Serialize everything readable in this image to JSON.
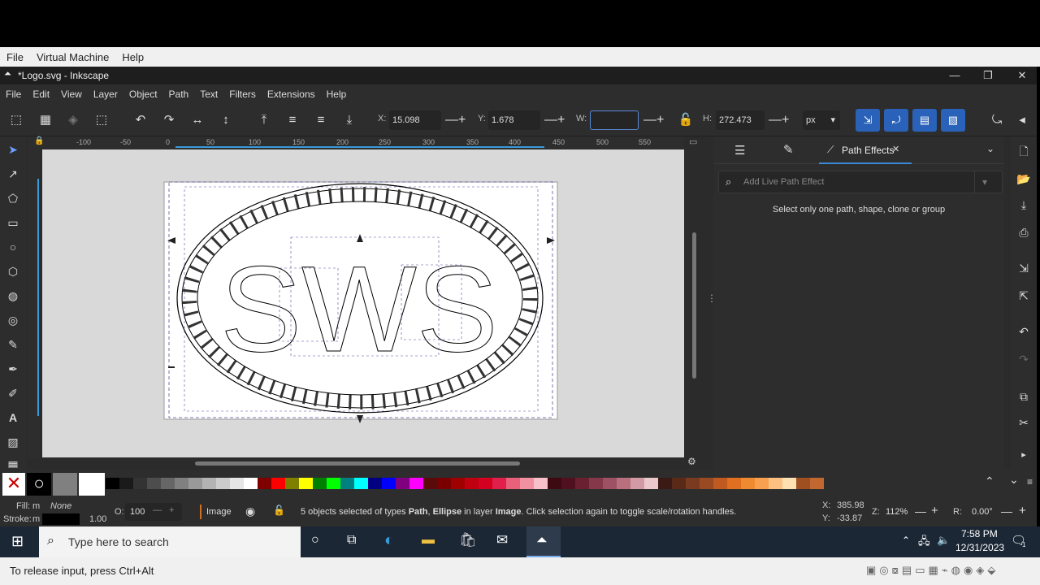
{
  "vm_menu": [
    "File",
    "Virtual Machine",
    "Help"
  ],
  "window": {
    "title": "*Logo.svg - Inkscape"
  },
  "menu": [
    "File",
    "Edit",
    "View",
    "Layer",
    "Object",
    "Path",
    "Text",
    "Filters",
    "Extensions",
    "Help"
  ],
  "toolbar": {
    "x_label": "X:",
    "x_value": "15.098",
    "y_label": "Y:",
    "y_value": "1.678",
    "w_label": "W:",
    "w_value": "",
    "h_label": "H:",
    "h_value": "272.473",
    "unit": "px"
  },
  "ruler": {
    "ticks": [
      "-100",
      "-50",
      "0",
      "50",
      "100",
      "150",
      "200",
      "250",
      "300",
      "350",
      "400",
      "450",
      "500",
      "550"
    ]
  },
  "panel": {
    "tab_label": "Path Effects",
    "search_placeholder": "Add Live Path Effect",
    "message": "Select only one path, shape, clone or group"
  },
  "status": {
    "fill_label": "Fill:",
    "fill_value": "m",
    "fill_none": "None",
    "stroke_label": "Stroke:",
    "stroke_value": "m",
    "stroke_width": "1.00",
    "opacity_label": "O:",
    "opacity_value": "100",
    "layer": "Image",
    "msg_pre": "5 objects selected of types ",
    "msg_types1": "Path",
    "msg_sep": ", ",
    "msg_types2": "Ellipse",
    "msg_mid": " in layer ",
    "msg_layer": "Image",
    "msg_post": ". Click selection again to toggle scale/rotation handles.",
    "x_coord": "385.98",
    "y_coord": "-33.87",
    "x_label": "X:",
    "y_label": "Y:",
    "zoom_label": "Z:",
    "zoom": "112%",
    "rot_label": "R:",
    "rotation": "0.00°"
  },
  "palette_colors": [
    "#000000",
    "#1a1a1a",
    "#333333",
    "#4d4d4d",
    "#666666",
    "#808080",
    "#999999",
    "#b3b3b3",
    "#cccccc",
    "#e6e6e6",
    "#ffffff",
    "#800000",
    "#ff0000",
    "#808000",
    "#ffff00",
    "#008000",
    "#00ff00",
    "#008080",
    "#00ffff",
    "#000080",
    "#0000ff",
    "#800080",
    "#ff00ff",
    "#5a0a0a",
    "#7a0000",
    "#a00000",
    "#c00010",
    "#d40020",
    "#e0204a",
    "#e8607a",
    "#f090a0",
    "#f8c0c8",
    "#3c0a10",
    "#501020",
    "#6a2030",
    "#84384a",
    "#9e5064",
    "#b8707e",
    "#d29aa4",
    "#ecc8cc",
    "#3a1a14",
    "#5a2a18",
    "#7a3a20",
    "#9a4a20",
    "#c05a20",
    "#e07020",
    "#f08a30",
    "#f8a050",
    "#fcc080",
    "#ffe0b0",
    "#a05020",
    "#c06830"
  ],
  "taskbar": {
    "search_placeholder": "Type here to search",
    "time": "7:58 PM",
    "date": "12/31/2023",
    "notif_count": "1"
  },
  "vm_status": "To release input, press Ctrl+Alt",
  "logo_letters": "SWS"
}
